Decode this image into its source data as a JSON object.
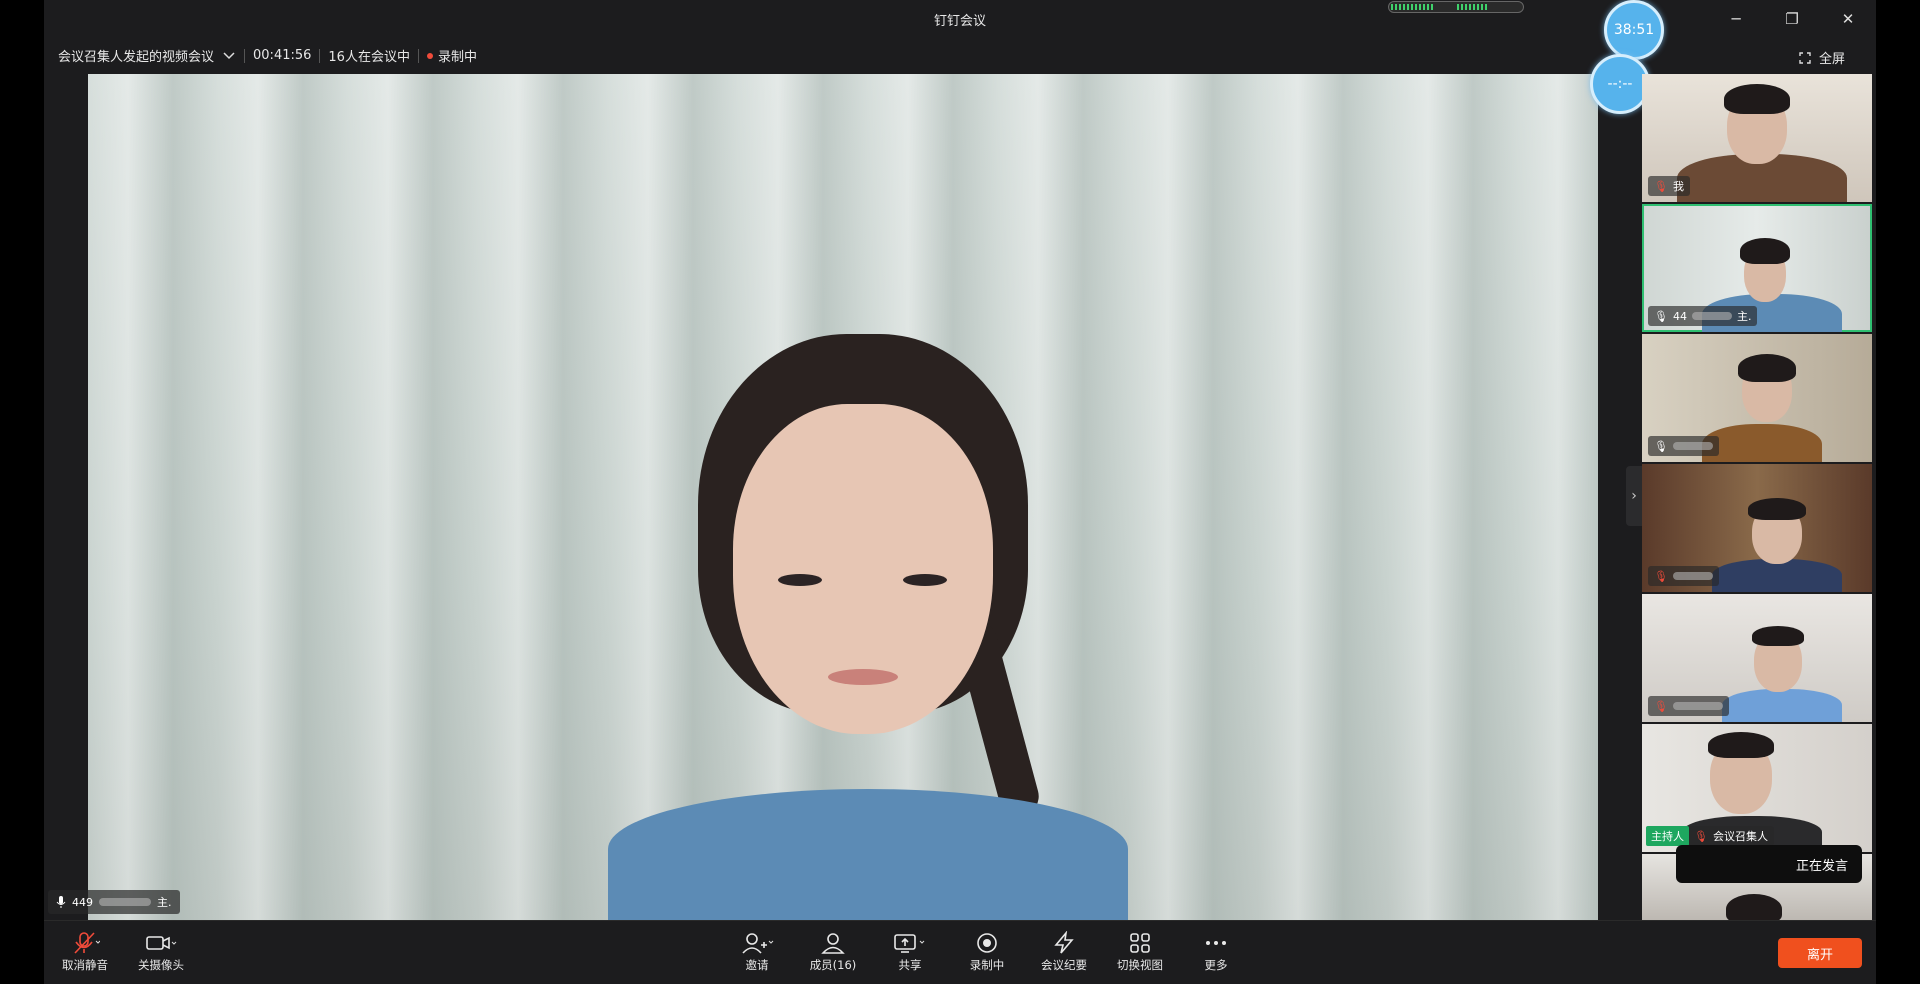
{
  "window": {
    "title": "钉钉会议",
    "controls": {
      "minimize": "─",
      "restore": "❐",
      "close": "✕"
    }
  },
  "info": {
    "meeting_name": "会议召集人发起的视频会议",
    "duration": "00:41:56",
    "participants": "16人在会议中",
    "recording": "录制中",
    "fullscreen": "全屏"
  },
  "timers": {
    "countdown": "38:51",
    "secondary": "--:--"
  },
  "main_video": {
    "speaker_label": "449",
    "speaker_suffix": "主."
  },
  "thumbnails": [
    {
      "label": "我",
      "muted": true
    },
    {
      "label": "44",
      "suffix": "主.",
      "muted": false,
      "active": true
    },
    {
      "label": "",
      "muted": false
    },
    {
      "label": "",
      "muted": true
    },
    {
      "label": "",
      "muted": true
    },
    {
      "host_badge": "主持人",
      "label": "会议召集人",
      "muted": true
    },
    {
      "label": "",
      "muted": false
    }
  ],
  "speaking_now": "正在发言",
  "toolbar": {
    "unmute": "取消静音",
    "camera_off": "关摄像头",
    "invite": "邀请",
    "members": "成员(16)",
    "share": "共享",
    "recording": "录制中",
    "minutes": "会议纪要",
    "switch_view": "切换视图",
    "more": "更多",
    "leave": "离开"
  },
  "colors": {
    "accent_green": "#2fbf71",
    "leave_orange": "#f0501e",
    "rec_red": "#f04b3a",
    "bubble_blue": "#56b3ec"
  },
  "icons": [
    "mic-muted-icon",
    "camera-icon",
    "add-person-icon",
    "members-icon",
    "share-screen-icon",
    "record-icon",
    "minutes-icon",
    "grid-view-icon",
    "more-icon",
    "fullscreen-icon",
    "chevron-down-icon",
    "chevron-right-icon",
    "mic-icon"
  ]
}
